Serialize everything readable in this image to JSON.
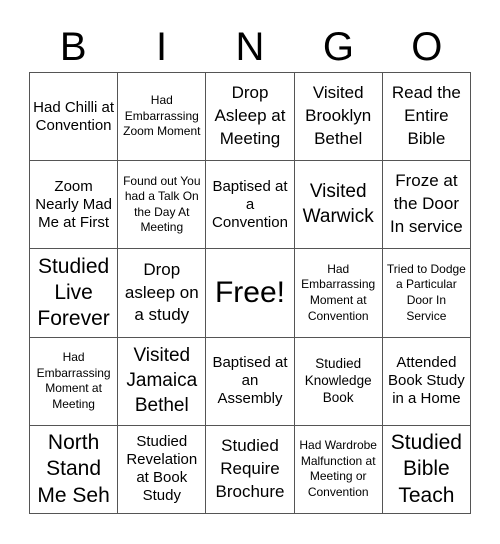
{
  "header": [
    "B",
    "I",
    "N",
    "G",
    "O"
  ],
  "cells": [
    [
      {
        "text": "Had Chilli at Convention",
        "size": "s-md"
      },
      {
        "text": "Had Embarrassing Zoom Moment",
        "size": "s-xs"
      },
      {
        "text": "Drop Asleep at Meeting",
        "size": "s-lg"
      },
      {
        "text": "Visited Brooklyn Bethel",
        "size": "s-lg"
      },
      {
        "text": "Read the Entire Bible",
        "size": "s-lg"
      }
    ],
    [
      {
        "text": "Zoom Nearly Mad Me at First",
        "size": "s-md"
      },
      {
        "text": "Found out You had a Talk On the Day At Meeting",
        "size": "s-xs"
      },
      {
        "text": "Baptised at a Convention",
        "size": "s-md"
      },
      {
        "text": "Visited Warwick",
        "size": "s-xl"
      },
      {
        "text": "Froze at the Door In service",
        "size": "s-lg"
      }
    ],
    [
      {
        "text": "Studied Live Forever",
        "size": "s-xxl"
      },
      {
        "text": "Drop asleep on a study",
        "size": "s-lg"
      },
      {
        "text": "Free!",
        "size": "s-free"
      },
      {
        "text": "Had Embarrassing Moment at Convention",
        "size": "s-xs"
      },
      {
        "text": "Tried to Dodge a Particular Door In Service",
        "size": "s-xs"
      }
    ],
    [
      {
        "text": "Had Embarrassing Moment at Meeting",
        "size": "s-xs"
      },
      {
        "text": "Visited Jamaica Bethel",
        "size": "s-xl"
      },
      {
        "text": "Baptised at an Assembly",
        "size": "s-md"
      },
      {
        "text": "Studied Knowledge Book",
        "size": "s-sm"
      },
      {
        "text": "Attended Book Study in a Home",
        "size": "s-md"
      }
    ],
    [
      {
        "text": "North Stand Me Seh",
        "size": "s-xxl"
      },
      {
        "text": "Studied Revelation at Book Study",
        "size": "s-md"
      },
      {
        "text": "Studied Require Brochure",
        "size": "s-lg"
      },
      {
        "text": "Had Wardrobe Malfunction at Meeting or Convention",
        "size": "s-xs"
      },
      {
        "text": "Studied Bible Teach",
        "size": "s-xxl"
      }
    ]
  ]
}
